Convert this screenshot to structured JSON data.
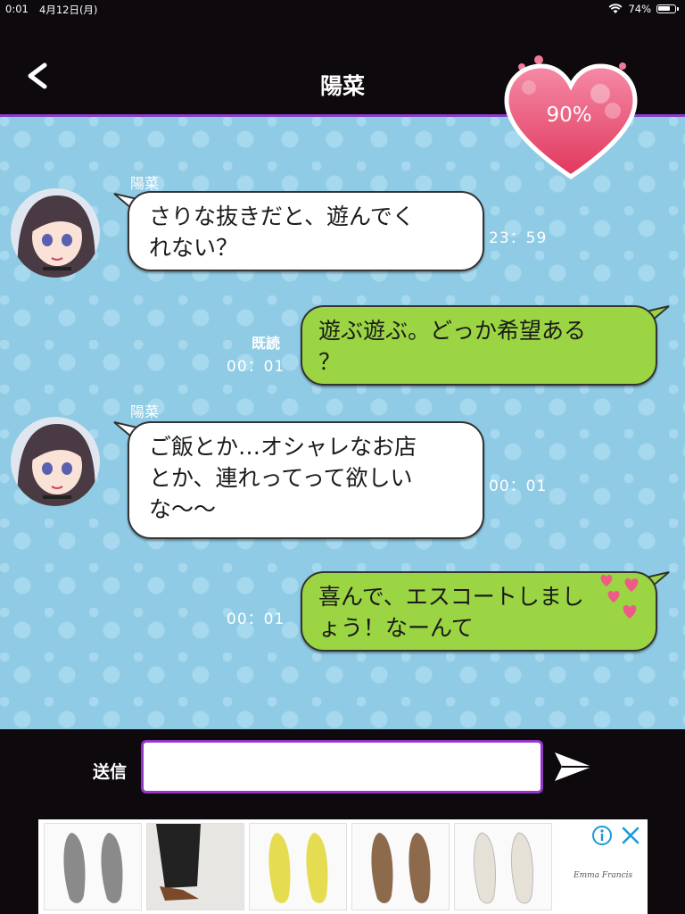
{
  "status_bar": {
    "time": "0:01",
    "date": "4月12日(月)",
    "battery": "74%"
  },
  "header": {
    "title": "陽菜",
    "affection": "90%"
  },
  "messages": [
    {
      "direction": "in",
      "sender": "陽菜",
      "lines": [
        "さりな抜きだと、遊んでく",
        "れない？"
      ],
      "time": "23：59"
    },
    {
      "direction": "out",
      "read": "既読",
      "lines": [
        "遊ぶ遊ぶ。どっか希望ある",
        "？"
      ],
      "time": "00：01"
    },
    {
      "direction": "in",
      "sender": "陽菜",
      "lines": [
        "ご飯とか…オシャレなお店",
        "とか、連れってって欲しい",
        "な〜〜"
      ],
      "time": "00：01"
    },
    {
      "direction": "out",
      "lines": [
        "喜んで、エスコートしまし",
        "ょう！なーんて"
      ],
      "time": "00：01"
    }
  ],
  "input": {
    "label": "送信",
    "value": ""
  },
  "ad": {
    "brand": "Emma Francis"
  },
  "colors": {
    "header_bg": "#0d090d",
    "accent": "#8a3fc8",
    "chat_bg": "#8fcbe4",
    "out_bubble": "#9bd543",
    "heart": "#e8476a"
  }
}
